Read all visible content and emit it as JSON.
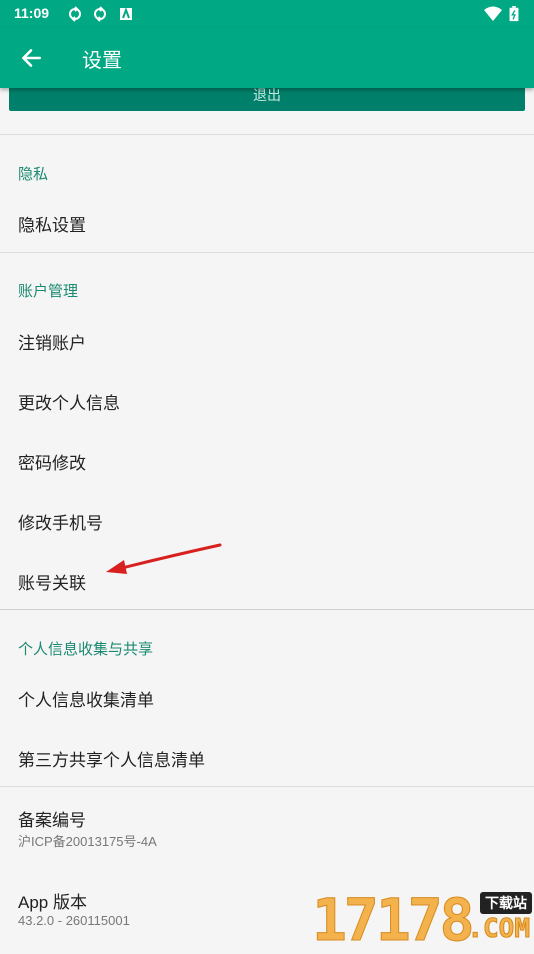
{
  "status_bar": {
    "time": "11:09"
  },
  "app_bar": {
    "title": "设置"
  },
  "hidden_button": {
    "label": "退出"
  },
  "sections": {
    "privacy": {
      "header": "隐私",
      "items": [
        "隐私设置"
      ]
    },
    "account": {
      "header": "账户管理",
      "items": [
        "注销账户",
        "更改个人信息",
        "密码修改",
        "修改手机号",
        "账号关联"
      ]
    },
    "personal_info": {
      "header": "个人信息收集与共享",
      "items": [
        "个人信息收集清单",
        "第三方共享个人信息清单"
      ]
    }
  },
  "record": {
    "title": "备案编号",
    "value": "沪ICP备20013175号-4A"
  },
  "app_version": {
    "title": "App 版本",
    "value": "43.2.0 - 260115001"
  },
  "watermark": {
    "digits": "17178",
    "badge": "下载站",
    "domain": ".COM"
  },
  "colors": {
    "accent": "#00a884",
    "section_text": "#1b8a72",
    "annotation_arrow": "#d8201e"
  }
}
